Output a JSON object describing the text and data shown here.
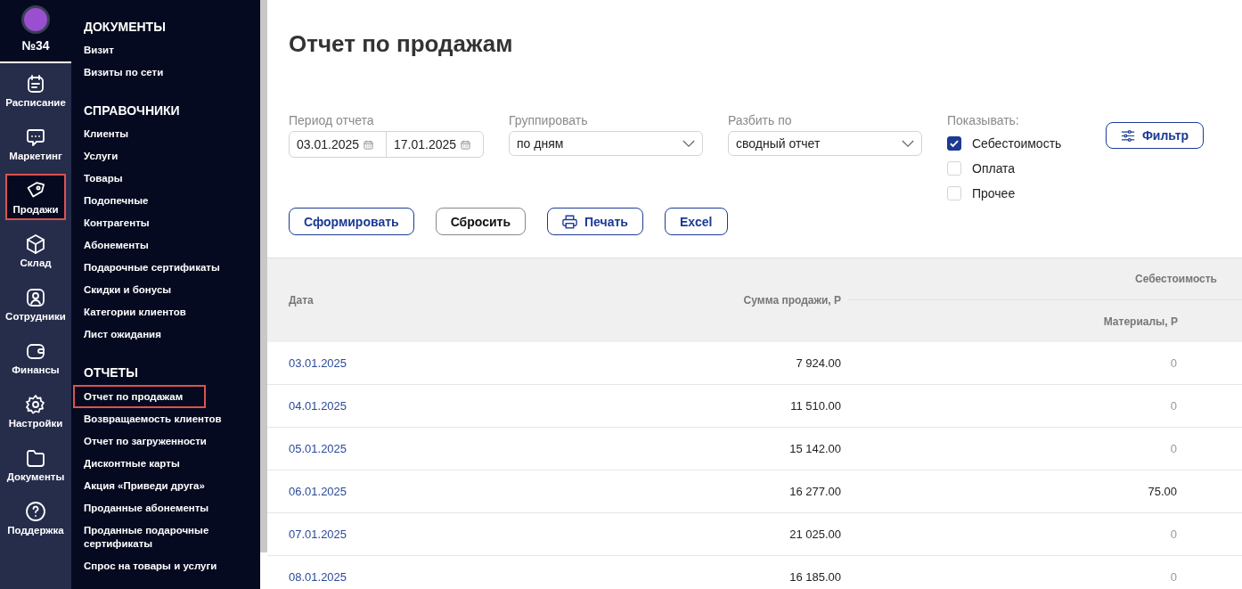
{
  "brand": {
    "number": "№34"
  },
  "rail": [
    {
      "label": "Расписание",
      "kind": "calendar",
      "selected": false,
      "highlighted": false
    },
    {
      "label": "Маркетинг",
      "kind": "chat",
      "selected": false,
      "highlighted": false
    },
    {
      "label": "Продажи",
      "kind": "tag",
      "selected": true,
      "highlighted": true
    },
    {
      "label": "Склад",
      "kind": "box",
      "selected": false,
      "highlighted": false
    },
    {
      "label": "Сотрудники",
      "kind": "user",
      "selected": false,
      "highlighted": false
    },
    {
      "label": "Финансы",
      "kind": "wallet",
      "selected": false,
      "highlighted": false
    },
    {
      "label": "Настройки",
      "kind": "gear",
      "selected": false,
      "highlighted": false
    },
    {
      "label": "Документы",
      "kind": "folder",
      "selected": false,
      "highlighted": false
    },
    {
      "label": "Поддержка",
      "kind": "help",
      "selected": false,
      "highlighted": false
    }
  ],
  "submenu": [
    {
      "title": "ДОКУМЕНТЫ",
      "items": [
        {
          "label": "Визит",
          "highlighted": false
        },
        {
          "label": "Визиты по сети",
          "highlighted": false
        }
      ]
    },
    {
      "title": "СПРАВОЧНИКИ",
      "items": [
        {
          "label": "Клиенты",
          "highlighted": false
        },
        {
          "label": "Услуги",
          "highlighted": false
        },
        {
          "label": "Товары",
          "highlighted": false
        },
        {
          "label": "Подопечные",
          "highlighted": false
        },
        {
          "label": "Контрагенты",
          "highlighted": false
        },
        {
          "label": "Абонементы",
          "highlighted": false
        },
        {
          "label": "Подарочные сертификаты",
          "highlighted": false
        },
        {
          "label": "Скидки и бонусы",
          "highlighted": false
        },
        {
          "label": "Категории клиентов",
          "highlighted": false
        },
        {
          "label": "Лист ожидания",
          "highlighted": false
        }
      ]
    },
    {
      "title": "ОТЧЕТЫ",
      "items": [
        {
          "label": "Отчет по продажам",
          "highlighted": true
        },
        {
          "label": "Возвращаемость клиентов",
          "highlighted": false
        },
        {
          "label": "Отчет по загруженности",
          "highlighted": false
        },
        {
          "label": "Дисконтные карты",
          "highlighted": false
        },
        {
          "label": "Акция «Приведи друга»",
          "highlighted": false
        },
        {
          "label": "Проданные абонементы",
          "highlighted": false
        },
        {
          "label": "Проданные подарочные сертификаты",
          "highlighted": false
        },
        {
          "label": "Спрос на товары и услуги",
          "highlighted": false
        }
      ]
    }
  ],
  "page_title": "Отчет по продажам",
  "filters": {
    "period": {
      "label": "Период отчета",
      "from": "03.01.2025",
      "to": "17.01.2025"
    },
    "group": {
      "label": "Группировать",
      "value": "по дням"
    },
    "split": {
      "label": "Разбить по",
      "value": "сводный отчет"
    },
    "show": {
      "label": "Показывать:",
      "options": [
        {
          "label": "Себестоимость",
          "checked": true
        },
        {
          "label": "Оплата",
          "checked": false
        },
        {
          "label": "Прочее",
          "checked": false
        }
      ]
    },
    "filter_button": "Фильтр"
  },
  "actions": [
    {
      "label": "Сформировать",
      "kind": "primary"
    },
    {
      "label": "Сбросить",
      "kind": "neutral"
    },
    {
      "label": "Печать",
      "kind": "print"
    },
    {
      "label": "Excel",
      "kind": "primary"
    }
  ],
  "table": {
    "columns": {
      "date": "Дата",
      "sum": "Сумма продажи, Р",
      "group": "Себестоимость",
      "materials": "Материалы, Р"
    },
    "rows": [
      {
        "date": "03.01.2025",
        "sum": "7 924.00",
        "materials": "0"
      },
      {
        "date": "04.01.2025",
        "sum": "11 510.00",
        "materials": "0"
      },
      {
        "date": "05.01.2025",
        "sum": "15 142.00",
        "materials": "0"
      },
      {
        "date": "06.01.2025",
        "sum": "16 277.00",
        "materials": "75.00"
      },
      {
        "date": "07.01.2025",
        "sum": "21 025.00",
        "materials": "0"
      },
      {
        "date": "08.01.2025",
        "sum": "16 185.00",
        "materials": "0"
      }
    ]
  }
}
